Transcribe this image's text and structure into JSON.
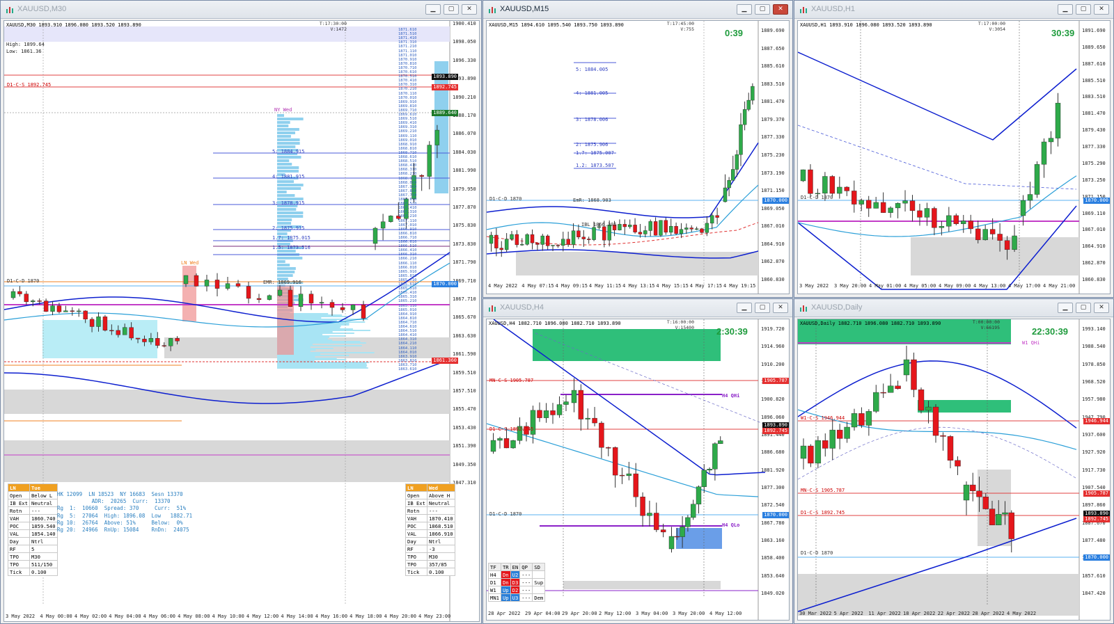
{
  "windows": {
    "m30": {
      "title": "XAUUSD,M30",
      "ohlc": "XAUUSD,M30  1893.910 1896.080 1893.520 1893.890",
      "time_vol": [
        "T:17:30:00",
        "V:1472"
      ],
      "high_low": [
        "High: 1899.64",
        "Low: 1861.36"
      ],
      "session_labels": {
        "ny": "NY Wed",
        "ln": "LN Wed",
        "emr": "EMR: 1869.916"
      },
      "levels": {
        "d1cs": "D1-C-S 1892.745",
        "d1cd": "D1-C-D 1870"
      },
      "fib_labels": [
        "5:  1884.915",
        "4:  1881.915",
        "3:  1878.915",
        "2:  1875.915",
        "1.7: 1875.015",
        "1.5: 1873.516"
      ],
      "price_tags": {
        "last": "1893.890",
        "d1cs": "1892.745",
        "tag3": "1889.640",
        "d1cd": "1870.000",
        "low": "1861.360"
      },
      "price_axis": [
        "1900.410",
        "1898.050",
        "1896.330",
        "1893.890",
        "1890.210",
        "1888.170",
        "1886.070",
        "1884.030",
        "1881.990",
        "1879.950",
        "1877.870",
        "1875.830",
        "1873.830",
        "1871.790",
        "1869.710",
        "1867.710",
        "1865.670",
        "1863.630",
        "1861.590",
        "1859.510",
        "1857.510",
        "1855.470",
        "1853.430",
        "1851.390",
        "1849.350",
        "1847.310"
      ],
      "time_axis": [
        "3 May 2022",
        "4 May 00:00",
        "4 May 02:00",
        "4 May 04:00",
        "4 May 06:00",
        "4 May 08:00",
        "4 May 10:00",
        "4 May 12:00",
        "4 May 14:00",
        "4 May 16:00",
        "4 May 18:00",
        "4 May 20:00",
        "4 May 23:00"
      ],
      "tpo_prices": [
        "1871.610",
        "1871.510",
        "1871.410",
        "1871.310",
        "1871.210",
        "1871.110",
        "1871.010",
        "1870.910",
        "1870.810",
        "1870.710",
        "1870.610",
        "1870.510",
        "1870.410",
        "1870.310",
        "1870.210",
        "1870.110",
        "1870.010",
        "1869.910",
        "1869.810",
        "1869.710",
        "1869.610",
        "1869.510",
        "1869.410",
        "1869.310",
        "1869.210",
        "1869.110",
        "1869.010",
        "1868.910",
        "1868.810",
        "1868.710",
        "1868.610",
        "1868.510",
        "1868.410",
        "1868.310",
        "1868.210",
        "1868.110",
        "1868.010",
        "1867.910",
        "1867.810",
        "1867.710",
        "1867.610",
        "1867.510",
        "1867.410",
        "1867.310",
        "1867.210",
        "1867.110",
        "1867.010",
        "1866.910",
        "1866.810",
        "1866.710",
        "1866.610",
        "1866.510",
        "1866.410",
        "1866.310",
        "1866.210",
        "1866.110",
        "1866.010",
        "1865.910",
        "1865.810",
        "1865.710",
        "1865.610",
        "1865.510",
        "1865.410",
        "1865.310",
        "1865.210",
        "1865.110",
        "1865.010",
        "1864.910",
        "1864.810",
        "1864.710",
        "1864.610",
        "1864.510",
        "1864.410",
        "1864.310",
        "1864.210",
        "1864.110",
        "1864.010",
        "1863.910",
        "1863.810",
        "1863.710",
        "1863.610"
      ],
      "ln_tue": {
        "header": [
          "LN",
          "Tue"
        ],
        "rows": [
          [
            "Open",
            "Below L"
          ],
          [
            "IB Ext",
            "Neutral"
          ],
          [
            "Rotn",
            "---"
          ],
          [
            "VAH",
            "1860.740"
          ],
          [
            "POC",
            "1859.540"
          ],
          [
            "VAL",
            "1854.140"
          ],
          [
            "Day",
            "Ntrl"
          ],
          [
            "RF",
            "5"
          ],
          [
            "TPO",
            "M30"
          ],
          [
            "TPO",
            "511/150"
          ],
          [
            "Tick",
            "0.100"
          ]
        ]
      },
      "ln_wed": {
        "header": [
          "LN",
          "Wed"
        ],
        "rows": [
          [
            "Open",
            "Above H"
          ],
          [
            "IB Ext",
            "Neutral"
          ],
          [
            "Rotn",
            "---"
          ],
          [
            "VAH",
            "1870.410"
          ],
          [
            "POC",
            "1868.510"
          ],
          [
            "VAL",
            "1866.910"
          ],
          [
            "Day",
            "Ntrl"
          ],
          [
            "RF",
            "-3"
          ],
          [
            "TPO",
            "M30"
          ],
          [
            "TPO",
            "357/85"
          ],
          [
            "Tick",
            "0.100"
          ]
        ]
      },
      "stats_lines": [
        "HK 12099  LN 18523  NY 16683  Sesn 13370",
        "           ADR:  20265  Curr:  13370",
        "Rg  1:  10660  Spread: 370     Curr:  51%",
        "Rg  5:  27064  High: 1896.08  Low   1882.71",
        "Rg 10:  26764  Above: 51%     Below:  0%",
        "Rg 20:  24966  RnUp: 15084    RnDn:  24075"
      ]
    },
    "m15": {
      "title": "XAUUSD,M15",
      "ohlc": "XAUUSD,M15  1894.610 1895.540 1893.750 1893.890",
      "time_vol": [
        "T:17:45:00",
        "V:755"
      ],
      "timer": "0:39",
      "fib_labels": [
        "5:  1884.005",
        "4:  1881.005",
        "3:  1878.006",
        "2:  1875.906",
        "1.7:  1875.007",
        "1.2:  1873.507"
      ],
      "levels": {
        "d1cd": "D1-C-D 1870",
        "emr": "EmR: 1868.903",
        "ib": "IBL 1866.305"
      },
      "price_tags": {
        "d1cd": "1870.000"
      },
      "price_axis": [
        "1889.690",
        "1887.650",
        "1885.610",
        "1883.510",
        "1881.470",
        "1879.370",
        "1877.330",
        "1875.230",
        "1873.190",
        "1871.150",
        "1869.050",
        "1867.010",
        "1864.910",
        "1862.870",
        "1860.830"
      ],
      "time_axis": [
        "4 May 2022",
        "4 May 07:15",
        "4 May 09:15",
        "4 May 11:15",
        "4 May 13:15",
        "4 May 15:15",
        "4 May 17:15",
        "4 May 19:15"
      ]
    },
    "h1": {
      "title": "XAUUSD,H1",
      "ohlc": "XAUUSD,H1  1893.910 1896.080 1893.520 1893.890",
      "time_vol": [
        "T:17:00:00",
        "V:3054"
      ],
      "timer": "30:39",
      "levels": {
        "d1cd": "D1-C-D 1870"
      },
      "price_tags": {
        "d1cd": "1870.000"
      },
      "price_axis": [
        "1891.690",
        "1889.650",
        "1887.610",
        "1885.510",
        "1883.510",
        "1881.470",
        "1879.430",
        "1877.330",
        "1875.290",
        "1873.250",
        "1871.150",
        "1869.110",
        "1867.010",
        "1864.910",
        "1862.870",
        "1860.830"
      ],
      "time_axis": [
        "3 May 2022",
        "3 May 20:00",
        "4 May 01:00",
        "4 May 05:00",
        "4 May 09:00",
        "4 May 13:00",
        "4 May 17:00",
        "4 May 21:00"
      ]
    },
    "h4": {
      "title": "XAUUSD,H4",
      "ohlc": "XAUUSD,H4  1882.710 1896.080 1882.710 1893.890",
      "time_vol": [
        "T:16:00:00",
        "V:15400"
      ],
      "timer": "2:30:39",
      "levels": {
        "mncs": "MN-C-S 1905.787",
        "d1cs": "D1-C-S 1892.745",
        "d1cd": "D1-C-D 1870",
        "qhi": "H4 QHi",
        "qlo": "H4 QLo"
      },
      "price_tags": {
        "mncs": "1905.787",
        "last": "1893.890",
        "d1cs": "1892.745",
        "d1cd": "1870.000"
      },
      "price_axis": [
        "1919.720",
        "1914.960",
        "1910.200",
        "1905.640",
        "1900.820",
        "1896.060",
        "1891.440",
        "1886.680",
        "1881.920",
        "1877.300",
        "1872.540",
        "1867.780",
        "1863.160",
        "1858.400",
        "1853.640",
        "1849.020"
      ],
      "time_axis": [
        "28 Apr 2022",
        "29 Apr 04:00",
        "29 Apr 20:00",
        "2 May 12:00",
        "3 May 04:00",
        "3 May 20:00",
        "4 May 12:00"
      ],
      "tf_table": {
        "header": [
          "TF",
          "TR",
          "EN",
          "QP",
          "SD"
        ],
        "rows": [
          [
            "H4",
            "Dn",
            "U2",
            "---",
            ""
          ],
          [
            "D1",
            "Dn",
            "D3",
            "---",
            "Sup"
          ],
          [
            "W1",
            "Up",
            "D2",
            "---",
            ""
          ],
          [
            "MN1",
            "Up",
            "U3",
            "---",
            "Dem"
          ]
        ]
      }
    },
    "daily": {
      "title": "XAUUSD,Daily",
      "ohlc": "XAUUSD,Daily  1882.710 1896.080 1882.710 1893.890",
      "time_vol": [
        "T:00:00:00",
        "V:66195"
      ],
      "timer": "22:30:39",
      "levels": {
        "w1": "W1 QHi",
        "w1cs": "W1-C-S 1946.944",
        "mncs": "MN-C-S 1905.787",
        "d1cs": "D1-C-S 1892.745",
        "d1cd": "D1-C-D 1870"
      },
      "price_tags": {
        "w1cs": "1946.944",
        "mncs": "1905.787",
        "last": "1893.890",
        "d1cs": "1892.745",
        "d1cd": "1870.000"
      },
      "price_axis": [
        "1993.140",
        "1988.540",
        "1978.850",
        "1968.520",
        "1957.980",
        "1947.790",
        "1937.600",
        "1927.920",
        "1917.730",
        "1907.540",
        "1897.860",
        "1887.670",
        "1877.480",
        "1867.290",
        "1857.610",
        "1847.420"
      ],
      "time_axis": [
        "30 Mar 2022",
        "5 Apr 2022",
        "11 Apr 2022",
        "18 Apr 2022",
        "22 Apr 2022",
        "28 Apr 2022",
        "4 May 2022"
      ]
    }
  },
  "colors": {
    "bull": "#2eaa4a",
    "bear": "#e5161b",
    "blue_band": "#0d1fcf",
    "light_blue": "#2a9fd8",
    "magenta": "#c33cc7",
    "zone_green": "#2fbf7a",
    "zone_grey": "#d8d8d8",
    "tpo_blue": "#8fd0ee",
    "orange": "#f0a020",
    "red_line": "#e04040"
  }
}
